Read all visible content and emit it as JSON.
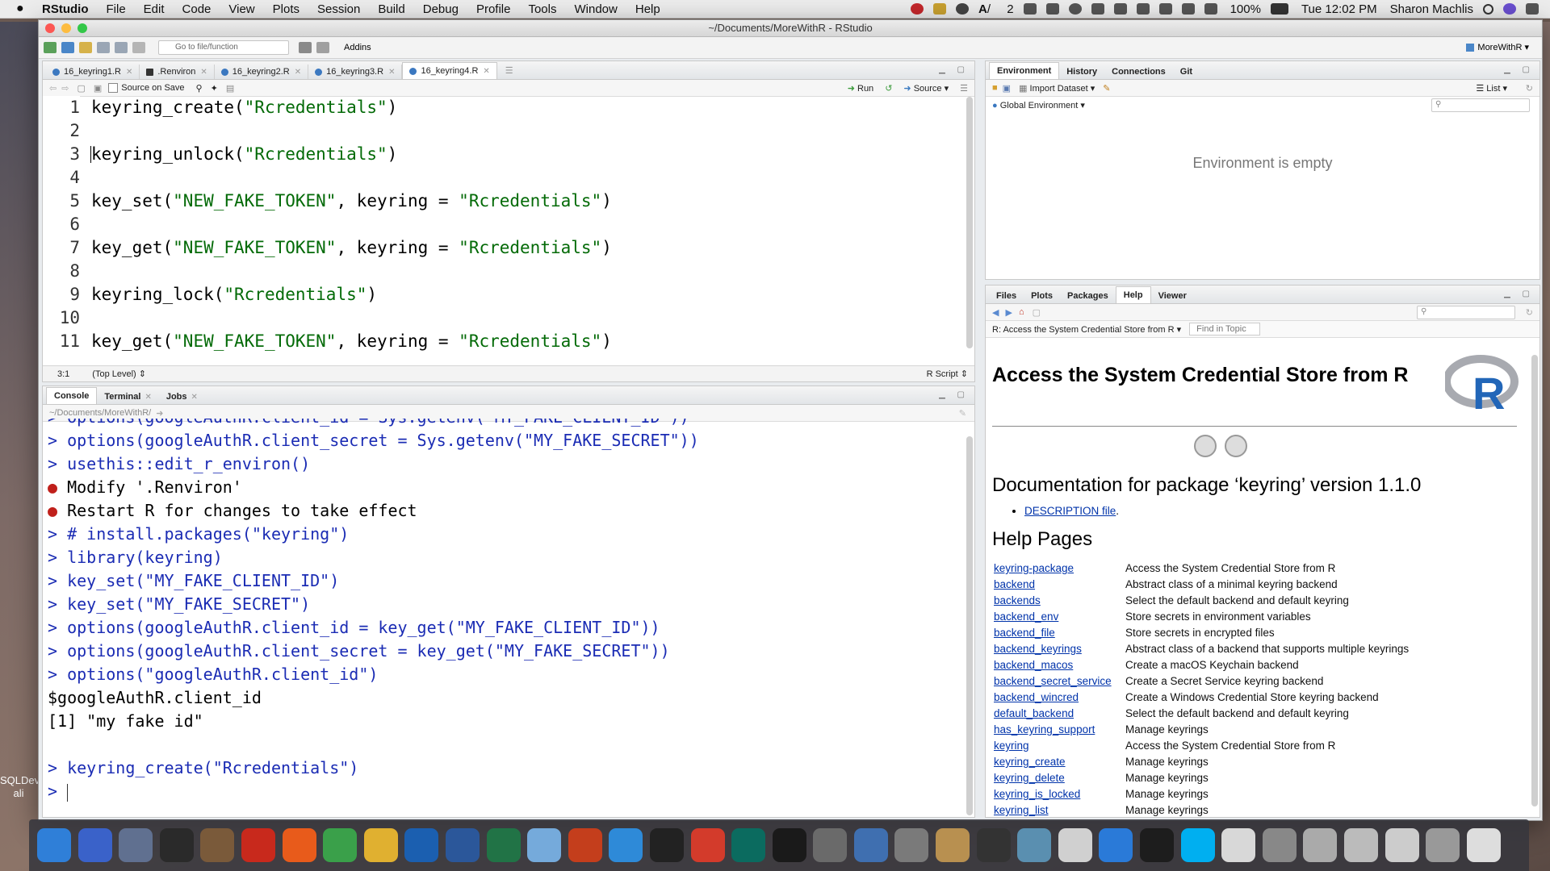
{
  "menubar": {
    "app_name": "RStudio",
    "items": [
      "File",
      "Edit",
      "Code",
      "View",
      "Plots",
      "Session",
      "Build",
      "Debug",
      "Profile",
      "Tools",
      "Window",
      "Help"
    ],
    "battery": "100%",
    "clock": "Tue 12:02 PM",
    "user": "Sharon Machlis",
    "status_badge": "2"
  },
  "window": {
    "title": "~/Documents/MoreWithR - RStudio"
  },
  "toolbar": {
    "goto_placeholder": "Go to file/function",
    "addins_label": "Addins",
    "project_label": "MoreWithR"
  },
  "editor": {
    "tabs": [
      {
        "label": "16_keyring1.R",
        "active": false
      },
      {
        "label": ".Renviron",
        "active": false
      },
      {
        "label": "16_keyring2.R",
        "active": false
      },
      {
        "label": "16_keyring3.R",
        "active": false
      },
      {
        "label": "16_keyring4.R",
        "active": true
      }
    ],
    "source_on_save_label": "Source on Save",
    "run_label": "Run",
    "source_label": "Source",
    "line_numbers": [
      "1",
      "2",
      "3",
      "4",
      "5",
      "6",
      "7",
      "8",
      "9",
      "10",
      "11"
    ],
    "lines": [
      {
        "pre": "keyring_create(",
        "str": "\"Rcredentials\"",
        "post": ")"
      },
      {
        "pre": "",
        "str": "",
        "post": ""
      },
      {
        "pre": "keyring_unlock(",
        "str": "\"Rcredentials\"",
        "post": ")"
      },
      {
        "pre": "",
        "str": "",
        "post": ""
      },
      {
        "pre": "key_set(",
        "str": "\"NEW_FAKE_TOKEN\"",
        "post": ", keyring = ",
        "str2": "\"Rcredentials\"",
        "post2": ")"
      },
      {
        "pre": "",
        "str": "",
        "post": ""
      },
      {
        "pre": "key_get(",
        "str": "\"NEW_FAKE_TOKEN\"",
        "post": ", keyring = ",
        "str2": "\"Rcredentials\"",
        "post2": ")"
      },
      {
        "pre": "",
        "str": "",
        "post": ""
      },
      {
        "pre": "keyring_lock(",
        "str": "\"Rcredentials\"",
        "post": ")"
      },
      {
        "pre": "",
        "str": "",
        "post": ""
      },
      {
        "pre": "key_get(",
        "str": "\"NEW_FAKE_TOKEN\"",
        "post": ", keyring = ",
        "str2": "\"Rcredentials\"",
        "post2": ")"
      }
    ],
    "cursor_position": "3:1",
    "scope": "(Top Level)",
    "file_type": "R Script"
  },
  "console": {
    "tabs": [
      "Console",
      "Terminal",
      "Jobs"
    ],
    "path": "~/Documents/MoreWithR/",
    "lines": [
      {
        "type": "prompt",
        "text": "> options(googleAuthR.client_id = Sys.getenv(\"MY_FAKE_CLIENT_ID\"))"
      },
      {
        "type": "prompt",
        "text": "> options(googleAuthR.client_secret = Sys.getenv(\"MY_FAKE_SECRET\"))"
      },
      {
        "type": "prompt",
        "text": "> usethis::edit_r_environ()"
      },
      {
        "type": "bullet",
        "text": "Modify '.Renviron'"
      },
      {
        "type": "bullet",
        "text": "Restart R for changes to take effect"
      },
      {
        "type": "prompt",
        "text": "> # install.packages(\"keyring\")"
      },
      {
        "type": "prompt",
        "text": "> library(keyring)"
      },
      {
        "type": "prompt",
        "text": "> key_set(\"MY_FAKE_CLIENT_ID\")"
      },
      {
        "type": "prompt",
        "text": "> key_set(\"MY_FAKE_SECRET\")"
      },
      {
        "type": "prompt",
        "text": "> options(googleAuthR.client_id = key_get(\"MY_FAKE_CLIENT_ID\"))"
      },
      {
        "type": "prompt",
        "text": "> options(googleAuthR.client_secret = key_get(\"MY_FAKE_SECRET\"))"
      },
      {
        "type": "prompt",
        "text": "> options(\"googleAuthR.client_id\")"
      },
      {
        "type": "out",
        "text": "$googleAuthR.client_id"
      },
      {
        "type": "out",
        "text": "[1] \"my fake id\""
      },
      {
        "type": "out",
        "text": ""
      },
      {
        "type": "prompt",
        "text": "> keyring_create(\"Rcredentials\")"
      },
      {
        "type": "prompt",
        "text": "> "
      }
    ]
  },
  "environment": {
    "tabs": [
      "Environment",
      "History",
      "Connections",
      "Git"
    ],
    "import_label": "Import Dataset",
    "view_label": "List",
    "scope_label": "Global Environment",
    "empty_message": "Environment is empty"
  },
  "help": {
    "tabs": [
      "Files",
      "Plots",
      "Packages",
      "Help",
      "Viewer"
    ],
    "topic_label": "R: Access the System Credential Store from R",
    "find_placeholder": "Find in Topic",
    "title": "Access the System Credential Store from R",
    "doc_heading": "Documentation for package ‘keyring’ version 1.1.0",
    "description_link": "DESCRIPTION file",
    "pages_heading": "Help Pages",
    "pages": [
      {
        "fn": "keyring-package",
        "desc": "Access the System Credential Store from R"
      },
      {
        "fn": "backend",
        "desc": "Abstract class of a minimal keyring backend"
      },
      {
        "fn": "backends",
        "desc": "Select the default backend and default keyring"
      },
      {
        "fn": "backend_env",
        "desc": "Store secrets in environment variables"
      },
      {
        "fn": "backend_file",
        "desc": "Store secrets in encrypted files"
      },
      {
        "fn": "backend_keyrings",
        "desc": "Abstract class of a backend that supports multiple keyrings"
      },
      {
        "fn": "backend_macos",
        "desc": "Create a macOS Keychain backend"
      },
      {
        "fn": "backend_secret_service",
        "desc": "Create a Secret Service keyring backend"
      },
      {
        "fn": "backend_wincred",
        "desc": "Create a Windows Credential Store keyring backend"
      },
      {
        "fn": "default_backend",
        "desc": "Select the default backend and default keyring"
      },
      {
        "fn": "has_keyring_support",
        "desc": "Manage keyrings"
      },
      {
        "fn": "keyring",
        "desc": "Access the System Credential Store from R"
      },
      {
        "fn": "keyring_create",
        "desc": "Manage keyrings"
      },
      {
        "fn": "keyring_delete",
        "desc": "Manage keyrings"
      },
      {
        "fn": "keyring_is_locked",
        "desc": "Manage keyrings"
      },
      {
        "fn": "keyring_list",
        "desc": "Manage keyrings"
      }
    ]
  },
  "desktop": {
    "left_label_1": "SQLDev",
    "left_label_2": "ali"
  },
  "dock": {
    "icon_colors": [
      "#2f7fd8",
      "#3a62c9",
      "#607090",
      "#2a2a2a",
      "#7a5a3a",
      "#c8291c",
      "#e85b1b",
      "#3aa04a",
      "#e0b030",
      "#1b5fb0",
      "#2b579a",
      "#217346",
      "#75aadb",
      "#c43e1c",
      "#2e8ad8",
      "#222222",
      "#d33b2b",
      "#0b6b5f",
      "#1a1a1a",
      "#6a6a6a",
      "#3f6fb0",
      "#7a7a7a",
      "#b89050",
      "#333333",
      "#5a8fb0",
      "#d0d0d0",
      "#2a7ad8",
      "#1d1d1d",
      "#00aff0",
      "#d8d8d8",
      "#888888",
      "#aaaaaa",
      "#bbbbbb",
      "#cccccc",
      "#999999",
      "#dddddd"
    ]
  }
}
